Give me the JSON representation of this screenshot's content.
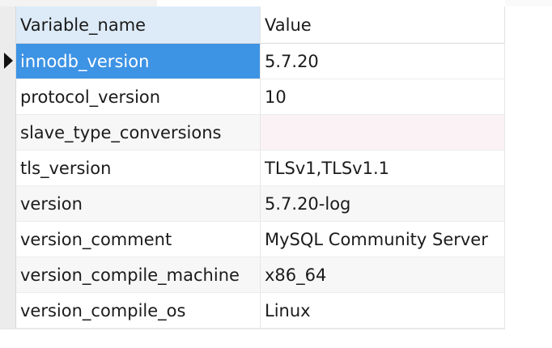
{
  "columns": {
    "name": "Variable_name",
    "value": "Value"
  },
  "rows": [
    {
      "name": "innodb_version",
      "value": "5.7.20",
      "selected": true
    },
    {
      "name": "protocol_version",
      "value": "10"
    },
    {
      "name": "slave_type_conversions",
      "value": ""
    },
    {
      "name": "tls_version",
      "value": "TLSv1,TLSv1.1"
    },
    {
      "name": "version",
      "value": "5.7.20-log"
    },
    {
      "name": "version_comment",
      "value": "MySQL Community Server"
    },
    {
      "name": "version_compile_machine",
      "value": "x86_64"
    },
    {
      "name": "version_compile_os",
      "value": "Linux"
    }
  ],
  "row_indicator_icon": "current-row-pointer-icon",
  "colors": {
    "selected_cell_bg": "#3d93e4",
    "header_active_bg": "#ddebf8",
    "null_cell_bg": "#fbf2f5"
  }
}
